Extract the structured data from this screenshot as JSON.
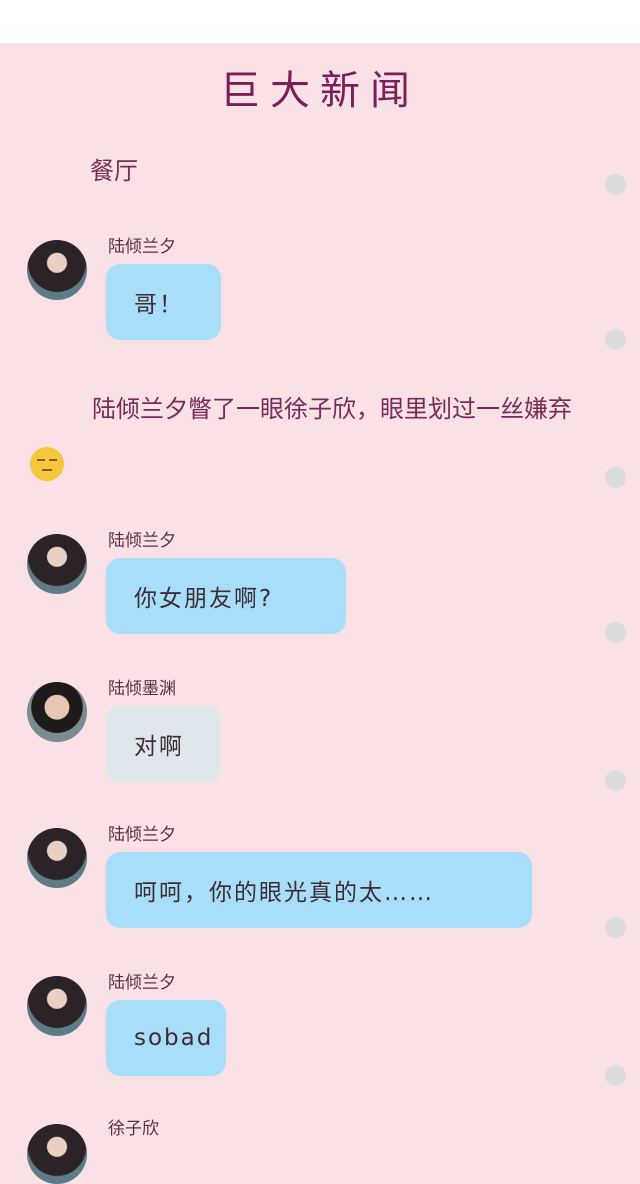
{
  "title": "巨大新闻",
  "narration": {
    "scene": "餐厅",
    "action": "陆倾兰夕瞥了一眼徐子欣，眼里划过一丝嫌弃"
  },
  "messages": [
    {
      "name": "陆倾兰夕",
      "text": "哥！",
      "avatar": "female-avatar",
      "bubble_color": "#a9defa"
    },
    {
      "name": "陆倾兰夕",
      "text": "你女朋友啊?",
      "avatar": "female-avatar",
      "bubble_color": "#a9defa"
    },
    {
      "name": "陆倾墨渊",
      "text": "对啊",
      "avatar": "male-avatar",
      "bubble_color": "#dfe6ec"
    },
    {
      "name": "陆倾兰夕",
      "text": "呵呵，你的眼光真的太……",
      "avatar": "female-avatar",
      "bubble_color": "#a9defa"
    },
    {
      "name": "陆倾兰夕",
      "text": "sobad",
      "avatar": "female-avatar",
      "bubble_color": "#a9defa"
    },
    {
      "name": "徐子欣",
      "text": "",
      "avatar": "female-avatar-2",
      "bubble_color": "#a9defa"
    }
  ],
  "emoji": "unamused-face-icon"
}
